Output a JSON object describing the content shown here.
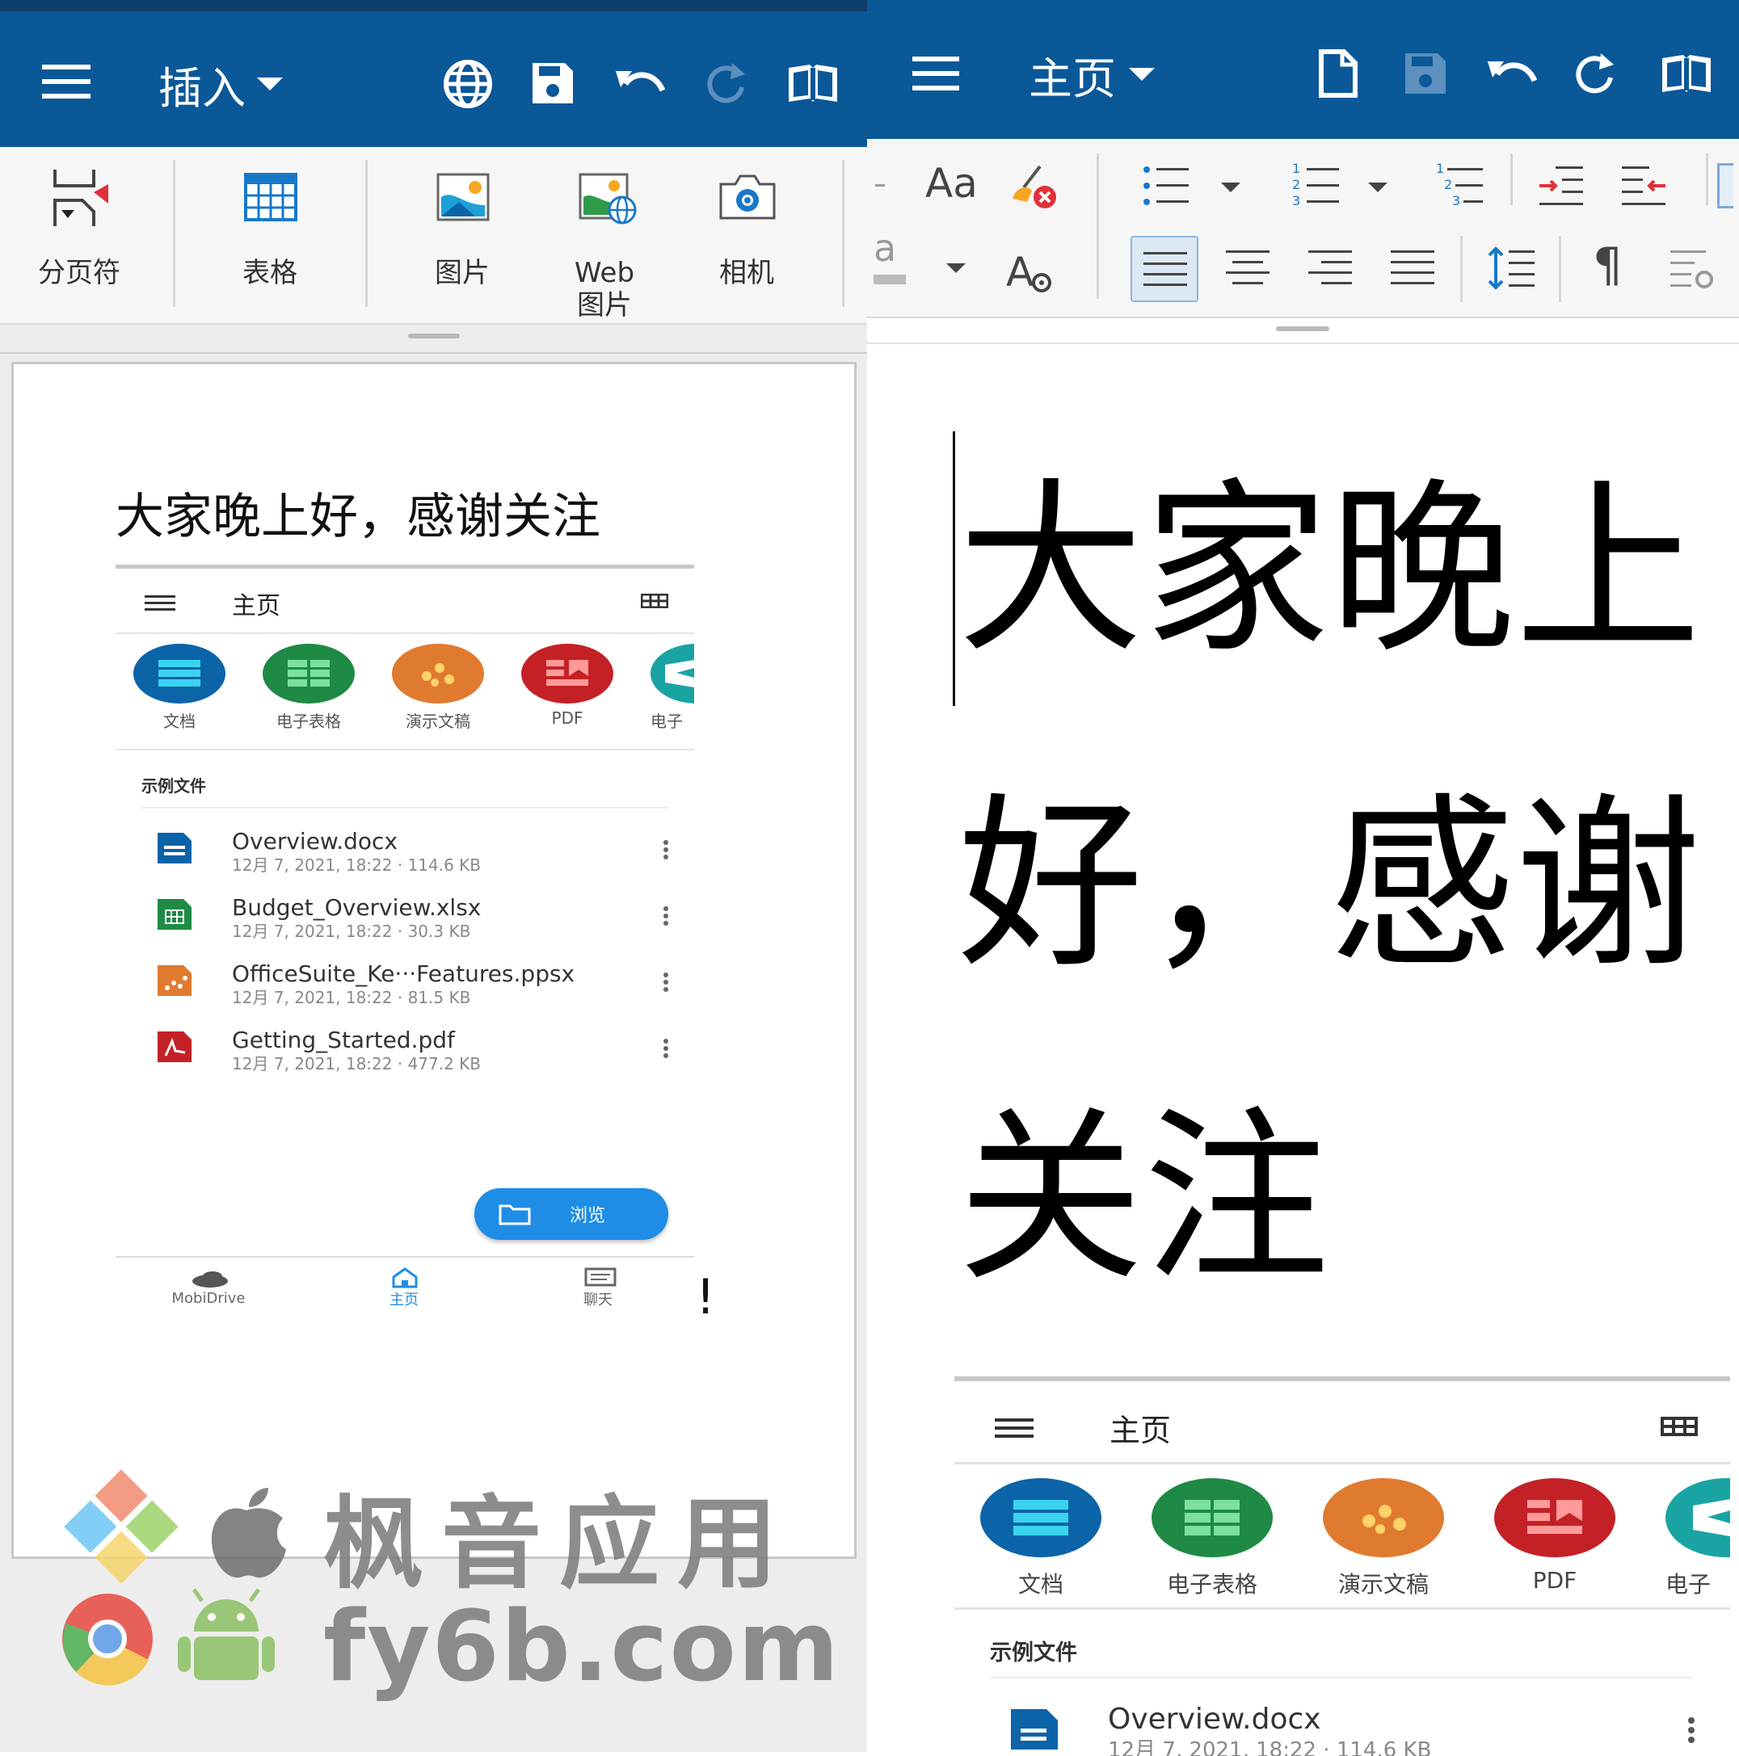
{
  "left": {
    "toolbar": {
      "menu_icon": "hamburger-icon",
      "mode_label": "插入",
      "icons": [
        "globe-icon",
        "save-icon",
        "undo-icon",
        "redo-icon",
        "book-icon"
      ]
    },
    "ribbon": [
      {
        "label": "分页符",
        "icon": "page-break-icon"
      },
      {
        "label": "表格",
        "icon": "table-icon"
      },
      {
        "label": "图片",
        "icon": "picture-icon"
      },
      {
        "label": "Web\n图片",
        "line1": "Web",
        "line2": "图片",
        "icon": "web-picture-icon"
      },
      {
        "label": "相机",
        "icon": "camera-icon"
      }
    ],
    "document": {
      "heading": "大家晚上好，感谢关注",
      "embedded_app": {
        "title": "主页",
        "categories": [
          {
            "label": "文档",
            "color": "#0b63a8"
          },
          {
            "label": "电子表格",
            "color": "#1e8a45"
          },
          {
            "label": "演示文稿",
            "color": "#e07a2f"
          },
          {
            "label": "PDF",
            "color": "#c42127"
          },
          {
            "label": "电子",
            "color": "#1aa3a3"
          }
        ],
        "section_title": "示例文件",
        "files": [
          {
            "name": "Overview.docx",
            "meta": "12月 7, 2021, 18:22 · 114.6 KB",
            "icon": "docx-icon",
            "color": "#0b63a8"
          },
          {
            "name": "Budget_Overview.xlsx",
            "meta": "12月 7, 2021, 18:22 · 30.3 KB",
            "icon": "xlsx-icon",
            "color": "#1e8a45"
          },
          {
            "name": "OfficeSuite_Ke···Features.ppsx",
            "meta": "12月 7, 2021, 18:22 · 81.5 KB",
            "icon": "ppsx-icon",
            "color": "#e07a2f"
          },
          {
            "name": "Getting_Started.pdf",
            "meta": "12月 7, 2021, 18:22 · 477.2 KB",
            "icon": "pdf-icon",
            "color": "#c42127"
          }
        ],
        "browse_label": "浏览",
        "bottom_nav": [
          {
            "label": "MobiDrive",
            "icon": "cloud-icon"
          },
          {
            "label": "主页",
            "icon": "home-icon"
          },
          {
            "label": "聊天",
            "icon": "chat-icon"
          }
        ]
      },
      "stray_mark": "!"
    }
  },
  "right": {
    "toolbar": {
      "menu_icon": "hamburger-icon",
      "mode_label": "主页",
      "icons": [
        "new-document-icon",
        "save-icon",
        "undo-icon",
        "redo-icon",
        "book-icon"
      ]
    },
    "ribbon_row1": [
      "font-size-icon",
      "clear-format-icon",
      "bullet-list-icon",
      "numbered-list-icon",
      "multilevel-list-icon",
      "increase-indent-icon",
      "decrease-indent-icon"
    ],
    "ribbon_row2": [
      "font-color-icon",
      "font-settings-icon",
      "align-left-icon",
      "align-center-icon",
      "align-right-icon",
      "justify-icon",
      "line-spacing-icon",
      "pilcrow-icon",
      "paragraph-settings-icon"
    ],
    "font_sample": "Aa",
    "color_sample": "a",
    "pilcrow": "¶",
    "document": {
      "line1": "大家晚上",
      "line2": "好，感谢",
      "line3": "关注",
      "embedded_app": {
        "title": "主页",
        "categories": [
          "文档",
          "电子表格",
          "演示文稿",
          "PDF",
          "电子"
        ],
        "section_title": "示例文件",
        "file": {
          "name": "Overview.docx",
          "meta": "12月 7, 2021, 18:22 · 114.6 KB"
        }
      }
    }
  },
  "watermark": {
    "line1": "枫音应用",
    "line2": "fy6b.com"
  }
}
